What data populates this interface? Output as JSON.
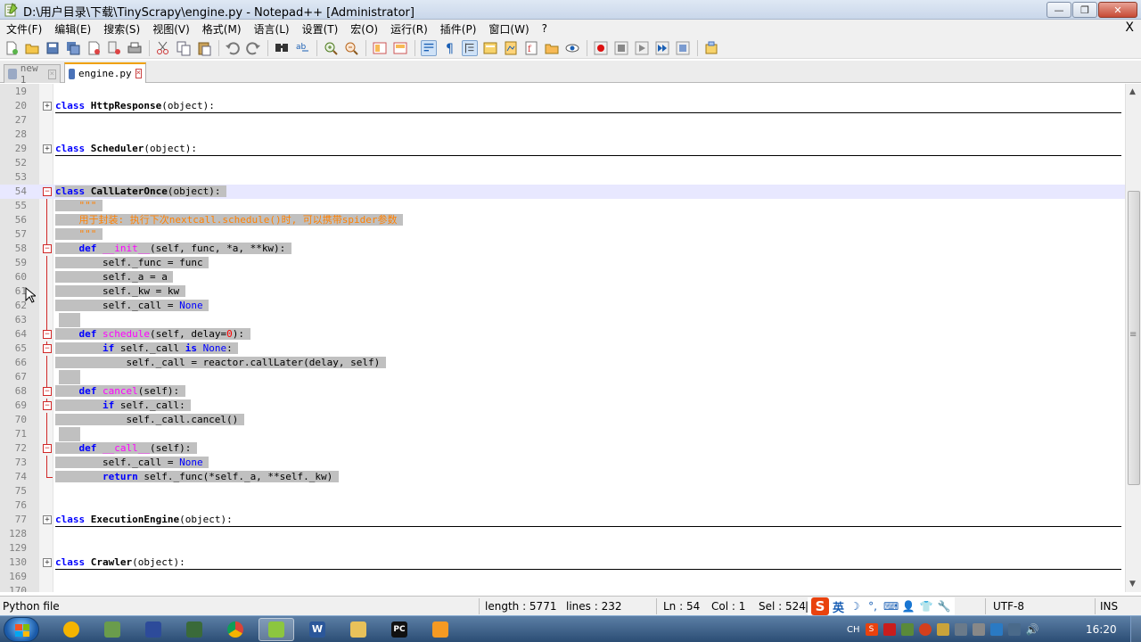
{
  "window": {
    "title": "D:\\用户目录\\下载\\TinyScrapy\\engine.py - Notepad++ [Administrator]",
    "minimize": "—",
    "restore": "❐",
    "close": "✕"
  },
  "menu": {
    "items": [
      "文件(F)",
      "编辑(E)",
      "搜索(S)",
      "视图(V)",
      "格式(M)",
      "语言(L)",
      "设置(T)",
      "宏(O)",
      "运行(R)",
      "插件(P)",
      "窗口(W)",
      "?"
    ],
    "close_doc": "X"
  },
  "tabs": [
    {
      "label": "new 1",
      "active": false
    },
    {
      "label": "engine.py",
      "active": true
    }
  ],
  "editor": {
    "lines": [
      {
        "n": "19",
        "fold": "",
        "text": ""
      },
      {
        "n": "20",
        "fold": "plus",
        "text": "class HttpResponse(object):"
      },
      {
        "n": "27",
        "fold": "",
        "text": ""
      },
      {
        "n": "28",
        "fold": "",
        "text": ""
      },
      {
        "n": "29",
        "fold": "plus",
        "text": "class Scheduler(object):"
      },
      {
        "n": "52",
        "fold": "",
        "text": ""
      },
      {
        "n": "53",
        "fold": "",
        "text": ""
      },
      {
        "n": "54",
        "fold": "minus",
        "text": "class CallLaterOnce(object):"
      },
      {
        "n": "55",
        "fold": "line",
        "text": "    \"\"\""
      },
      {
        "n": "56",
        "fold": "line",
        "text": "    用于封装: 执行下次nextcall.schedule()时, 可以携带spider参数"
      },
      {
        "n": "57",
        "fold": "line",
        "text": "    \"\"\""
      },
      {
        "n": "58",
        "fold": "minus",
        "text": "    def __init__(self, func, *a, **kw):"
      },
      {
        "n": "59",
        "fold": "line",
        "text": "        self._func = func"
      },
      {
        "n": "60",
        "fold": "line",
        "text": "        self._a = a"
      },
      {
        "n": "61",
        "fold": "line",
        "text": "        self._kw = kw"
      },
      {
        "n": "62",
        "fold": "line",
        "text": "        self._call = None"
      },
      {
        "n": "63",
        "fold": "line",
        "text": ""
      },
      {
        "n": "64",
        "fold": "minus",
        "text": "    def schedule(self, delay=0):"
      },
      {
        "n": "65",
        "fold": "minus",
        "text": "        if self._call is None:"
      },
      {
        "n": "66",
        "fold": "line",
        "text": "            self._call = reactor.callLater(delay, self)"
      },
      {
        "n": "67",
        "fold": "line",
        "text": ""
      },
      {
        "n": "68",
        "fold": "minus",
        "text": "    def cancel(self):"
      },
      {
        "n": "69",
        "fold": "minus",
        "text": "        if self._call:"
      },
      {
        "n": "70",
        "fold": "line",
        "text": "            self._call.cancel()"
      },
      {
        "n": "71",
        "fold": "line",
        "text": ""
      },
      {
        "n": "72",
        "fold": "minus",
        "text": "    def __call__(self):"
      },
      {
        "n": "73",
        "fold": "line",
        "text": "        self._call = None"
      },
      {
        "n": "74",
        "fold": "end",
        "text": "        return self._func(*self._a, **self._kw)"
      },
      {
        "n": "75",
        "fold": "",
        "text": ""
      },
      {
        "n": "76",
        "fold": "",
        "text": ""
      },
      {
        "n": "77",
        "fold": "plus",
        "text": "class ExecutionEngine(object):"
      },
      {
        "n": "128",
        "fold": "",
        "text": ""
      },
      {
        "n": "129",
        "fold": "",
        "text": ""
      },
      {
        "n": "130",
        "fold": "plus",
        "text": "class Crawler(object):"
      },
      {
        "n": "169",
        "fold": "",
        "text": ""
      },
      {
        "n": "170",
        "fold": "",
        "text": ""
      }
    ]
  },
  "status": {
    "file_type": "Python file",
    "length": "length : 5771",
    "lines": "lines : 232",
    "ln": "Ln : 54",
    "col": "Col : 1",
    "sel": "Sel : 524",
    "sel_sep": "|",
    "encoding": "UTF-8",
    "mode": "INS"
  },
  "ime": {
    "logo": "S",
    "mode": "英",
    "icons": [
      "☽",
      "°,",
      "⌨",
      "👤",
      "👕",
      "🔧"
    ]
  },
  "taskbar": {
    "lang": "CH",
    "clock": "16:20"
  },
  "colors": {
    "keyword": "#0000ff",
    "function_name": "#ff00ff",
    "string": "#ff8000",
    "number": "#ff0000",
    "selection": "#c0c0c0",
    "fold_marker": "#d02828"
  }
}
